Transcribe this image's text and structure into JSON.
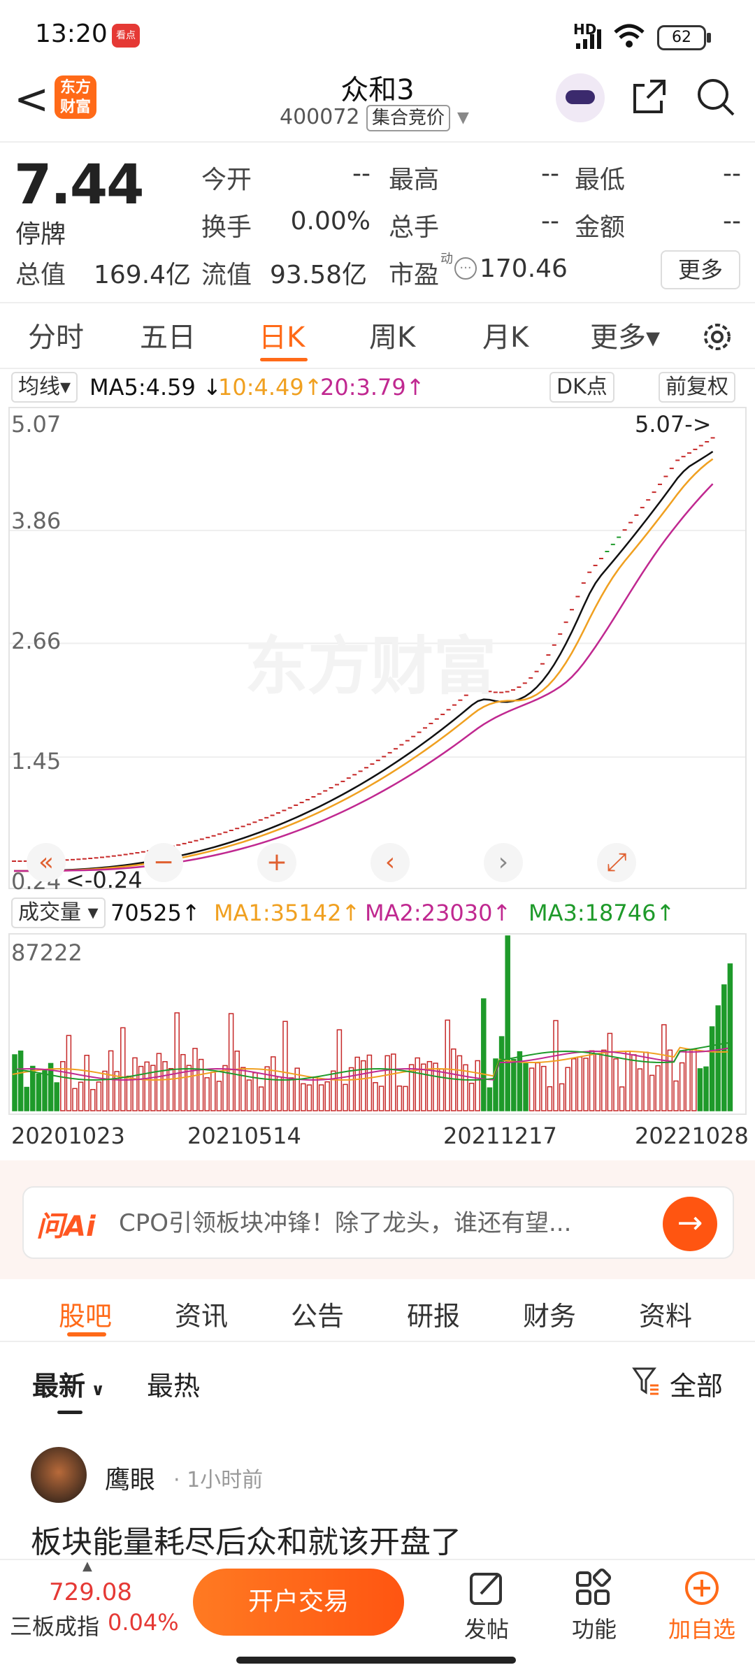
{
  "status": {
    "time": "13:20",
    "app_badge": "看点",
    "network": "HD",
    "battery": "62"
  },
  "header": {
    "back": "<",
    "logo_text": "东方\n财富",
    "title": "众和3",
    "code": "400072",
    "auction": "集合竞价"
  },
  "quote": {
    "price": "7.44",
    "status": "停牌",
    "open_label": "今开",
    "open": "--",
    "high_label": "最高",
    "high": "--",
    "low_label": "最低",
    "low": "--",
    "turnover_label": "换手",
    "turnover": "0.00%",
    "volume_label": "总手",
    "volume": "--",
    "amount_label": "金额",
    "amount": "--",
    "mcap_label": "总值",
    "mcap": "169.4亿",
    "float_label": "流值",
    "float": "93.58亿",
    "pe_label": "市盈",
    "pe_sup": "动",
    "pe": "170.46",
    "more": "更多"
  },
  "tabs": {
    "t1": "分时",
    "t2": "五日",
    "t3": "日K",
    "t4": "周K",
    "t5": "月K",
    "t6": "更多▾"
  },
  "indicators": {
    "ma_select": "均线▾",
    "ma5": "MA5:4.59 ↓",
    "ma10": "10:4.49↑",
    "ma20": "20:3.79↑",
    "dk": "DK点",
    "adjust": "前复权",
    "vol_select": "成交量 ▾",
    "vol": "70525↑",
    "vma1": "MA1:35142↑",
    "vma2": "MA2:23030↑",
    "vma3": "MA3:18746↑"
  },
  "colors": {
    "accent": "#ff6a18",
    "up": "#c62828",
    "down": "#1e9a2a",
    "ma5": "#111111",
    "ma10": "#f0a020",
    "ma20": "#c02890"
  },
  "chart_data": {
    "type": "candlestick",
    "yticks": [
      "5.07",
      "3.86",
      "2.66",
      "1.45",
      "0.24"
    ],
    "ylim": [
      0.24,
      5.07
    ],
    "max_marker": "5.07->",
    "min_marker": "<-0.24",
    "watermark": "东方财富",
    "vol_ytick": "87222",
    "dates": [
      "20201023",
      "20210514",
      "20211217",
      "20221028"
    ]
  },
  "nav_buttons": {
    "rewind": "«",
    "zoom_out": "−",
    "zoom_in": "+",
    "prev": "‹",
    "next": "›",
    "expand": "⤢"
  },
  "ai": {
    "logo": "问Ai",
    "text": "CPO引领板块冲锋！除了龙头，谁还有望...",
    "go": "→"
  },
  "subtabs": {
    "s1": "股吧",
    "s2": "资讯",
    "s3": "公告",
    "s4": "研报",
    "s5": "财务",
    "s6": "资料"
  },
  "sort": {
    "latest": "最新",
    "hot": "最热",
    "filter": "全部"
  },
  "post": {
    "user": "鹰眼",
    "time": "· 1小时前",
    "title": "板块能量耗尽后众和就该开盘了"
  },
  "bottom": {
    "index_value": "729.08",
    "index_name": "三板成指",
    "index_pct": "0.04%",
    "trade": "开户交易",
    "post": "发帖",
    "func": "功能",
    "add": "加自选"
  }
}
